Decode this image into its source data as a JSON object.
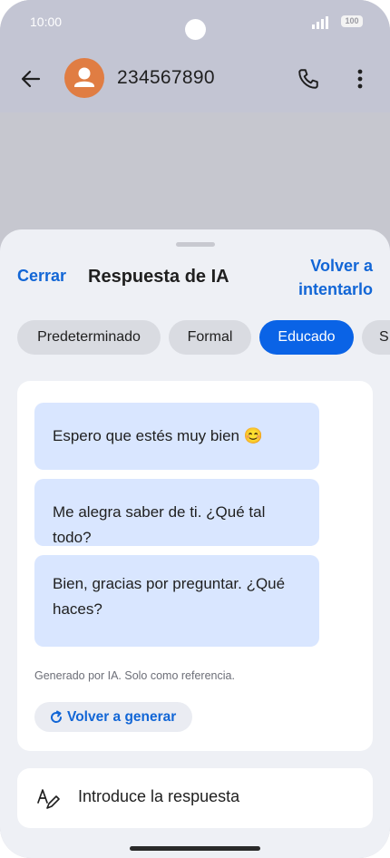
{
  "status": {
    "time": "10:00",
    "battery": "100"
  },
  "header": {
    "contact_number": "234567890"
  },
  "sheet": {
    "close_label": "Cerrar",
    "title": "Respuesta de IA",
    "retry_label": "Volver a intentarlo",
    "retry_line1": "Volver a",
    "retry_line2": "intentarlo",
    "tones": [
      {
        "label": "Predeterminado",
        "selected": false
      },
      {
        "label": "Formal",
        "selected": false
      },
      {
        "label": "Educado",
        "selected": true
      },
      {
        "label": "S",
        "selected": false
      }
    ],
    "suggestions": [
      "Espero que estés muy bien 😊",
      "Me alegra saber de ti. ¿Qué tal todo?",
      "Bien, gracias por preguntar. ¿Qué haces?"
    ],
    "disclaimer": "Generado por IA. Solo como referencia.",
    "regenerate_label": "Volver a generar"
  },
  "compose": {
    "placeholder": "Introduce la respuesta"
  },
  "colors": {
    "accent": "#0a63e6",
    "link": "#1266d6",
    "bubble": "#d9e6ff",
    "avatar": "#e07d43"
  },
  "icons": [
    "back-arrow-icon",
    "person-icon",
    "phone-icon",
    "more-vert-icon",
    "refresh-icon",
    "handwriting-icon"
  ]
}
